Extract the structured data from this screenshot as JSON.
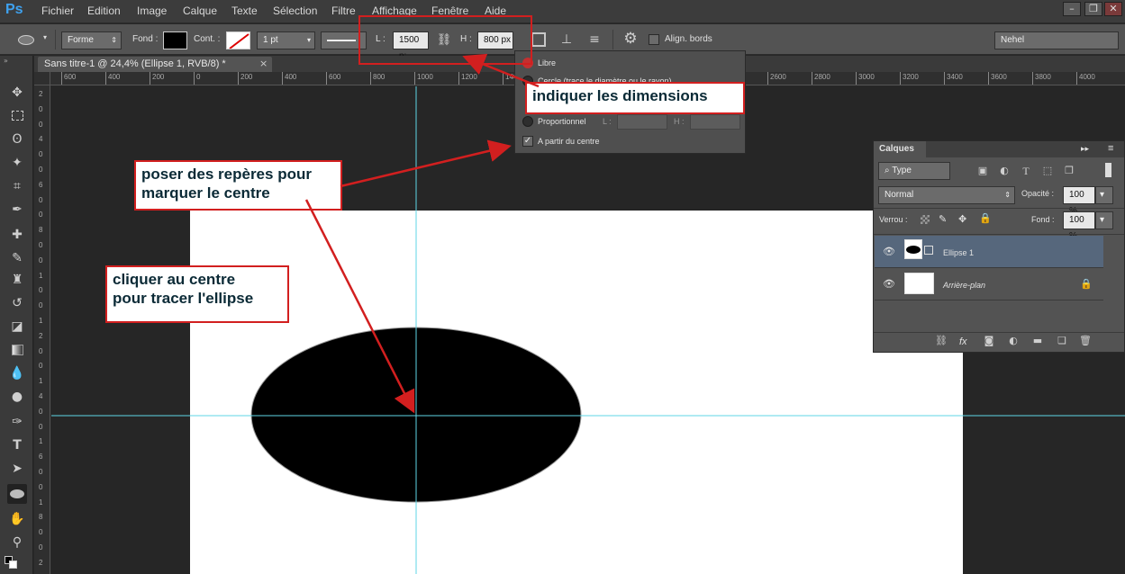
{
  "app": {
    "logo": "Ps"
  },
  "menu": [
    "Fichier",
    "Edition",
    "Image",
    "Calque",
    "Texte",
    "Sélection",
    "Filtre",
    "Affichage",
    "Fenêtre",
    "Aide"
  ],
  "options": {
    "mode": "Forme",
    "fill_label": "Fond :",
    "stroke_label": "Cont. :",
    "stroke_width": "1 pt",
    "w_label": "L :",
    "w_value": "1500 p:",
    "h_label": "H :",
    "h_value": "800 px",
    "align_edges": "Align. bords",
    "workspace": "Nehel"
  },
  "document": {
    "tab_title": "Sans titre-1 @ 24,4% (Ellipse 1, RVB/8) *",
    "close": "×"
  },
  "ruler": {
    "h_ticks": [
      "600",
      "400",
      "200",
      "0",
      "200",
      "400",
      "600",
      "800",
      "1000",
      "1200",
      "1400",
      "1600",
      "1800",
      "2000",
      "2200",
      "2400",
      "2600",
      "2800",
      "3000",
      "3200",
      "3400",
      "3600",
      "3800",
      "4000"
    ],
    "v_ticks": [
      "2",
      "0",
      "0",
      "4",
      "0",
      "0",
      "6",
      "0",
      "0",
      "8",
      "0",
      "0",
      "1",
      "0",
      "0",
      "1",
      "2",
      "0",
      "0",
      "1",
      "4",
      "0",
      "0",
      "1",
      "6",
      "0",
      "0",
      "1",
      "8",
      "0",
      "0",
      "2"
    ]
  },
  "shape_options": {
    "libre": "Libre",
    "cercle": "Cercle (trace le diamètre ou le rayon)",
    "proportionnel": "Proportionnel",
    "prop_l": "L :",
    "prop_h": "H :",
    "from_center": "A partir du centre"
  },
  "layers": {
    "title": "Calques",
    "filter": "Type",
    "blend": "Normal",
    "opacity_label": "Opacité :",
    "opacity": "100 %",
    "lock_label": "Verrou :",
    "fill_label": "Fond :",
    "fill": "100 %",
    "items": [
      {
        "name": "Ellipse 1",
        "selected": true
      },
      {
        "name": "Arrière-plan",
        "selected": false
      }
    ],
    "footer_fx": "fx"
  },
  "annotations": {
    "dimensions": "indiquer les dimensions",
    "guides_line1": "poser des repères pour",
    "guides_line2": "marquer le centre",
    "click_line1": "cliquer au centre",
    "click_line2": "pour tracer l'ellipse"
  },
  "colors": {
    "guide": "#5fd6e6",
    "annotation": "#d21f1f",
    "selection": "#56677c"
  }
}
